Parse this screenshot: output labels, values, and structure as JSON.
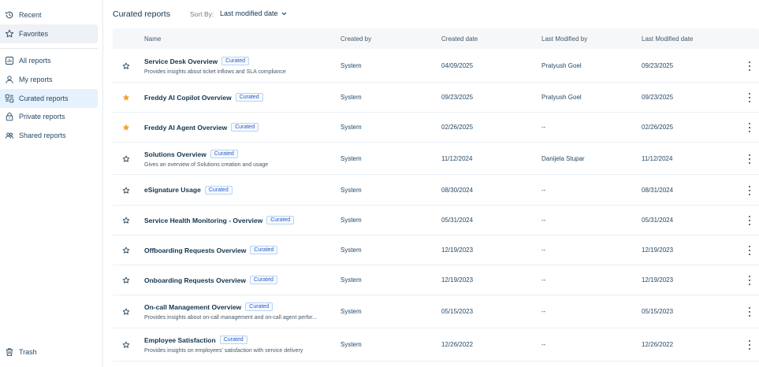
{
  "sidebar": {
    "items": [
      {
        "label": "Recent",
        "icon": "history-icon"
      },
      {
        "label": "Favorites",
        "icon": "star-outline-icon"
      },
      {
        "label": "All reports",
        "icon": "reports-icon"
      },
      {
        "label": "My reports",
        "icon": "user-icon"
      },
      {
        "label": "Curated reports",
        "icon": "curated-icon"
      },
      {
        "label": "Private reports",
        "icon": "lock-icon"
      },
      {
        "label": "Shared reports",
        "icon": "users-icon"
      }
    ],
    "trash": {
      "label": "Trash",
      "icon": "trash-icon"
    }
  },
  "header": {
    "title": "Curated reports",
    "sort_label": "Sort By:",
    "sort_value": "Last modified date"
  },
  "table": {
    "columns": [
      "Name",
      "Created by",
      "Created date",
      "Last Modified by",
      "Last Modified date"
    ],
    "badge_label": "Curated",
    "rows": [
      {
        "name": "Service Desk Overview",
        "desc": "Provides insights about ticket inflows and SLA compliance",
        "favorite": false,
        "created_by": "System",
        "created_date": "04/09/2025",
        "modified_by": "Pratyush Goel",
        "modified_date": "09/23/2025"
      },
      {
        "name": "Freddy AI Copilot Overview",
        "desc": "",
        "favorite": true,
        "created_by": "System",
        "created_date": "09/23/2025",
        "modified_by": "Pratyush Goel",
        "modified_date": "09/23/2025"
      },
      {
        "name": "Freddy AI Agent Overview",
        "desc": "",
        "favorite": true,
        "created_by": "System",
        "created_date": "02/26/2025",
        "modified_by": "--",
        "modified_date": "02/26/2025"
      },
      {
        "name": "Solutions Overview",
        "desc": "Gives an overview of Solutions creation and usage",
        "favorite": false,
        "created_by": "System",
        "created_date": "11/12/2024",
        "modified_by": "Danijela Stupar",
        "modified_date": "11/12/2024"
      },
      {
        "name": "eSignature Usage",
        "desc": "",
        "favorite": false,
        "created_by": "System",
        "created_date": "08/30/2024",
        "modified_by": "--",
        "modified_date": "08/31/2024"
      },
      {
        "name": "Service Health Monitoring - Overview",
        "desc": "",
        "favorite": false,
        "created_by": "System",
        "created_date": "05/31/2024",
        "modified_by": "--",
        "modified_date": "05/31/2024"
      },
      {
        "name": "Offboarding Requests Overview",
        "desc": "",
        "favorite": false,
        "created_by": "System",
        "created_date": "12/19/2023",
        "modified_by": "--",
        "modified_date": "12/19/2023"
      },
      {
        "name": "Onboarding Requests Overview",
        "desc": "",
        "favorite": false,
        "created_by": "System",
        "created_date": "12/19/2023",
        "modified_by": "--",
        "modified_date": "12/19/2023"
      },
      {
        "name": "On-call Management Overview",
        "desc": "Provides insights about on-call management and on-call agent perfor...",
        "favorite": false,
        "created_by": "System",
        "created_date": "05/15/2023",
        "modified_by": "--",
        "modified_date": "05/15/2023"
      },
      {
        "name": "Employee Satisfaction",
        "desc": "Provides insights on employees' satisfaction with service delivery",
        "favorite": false,
        "created_by": "System",
        "created_date": "12/26/2022",
        "modified_by": "--",
        "modified_date": "12/26/2022"
      }
    ]
  },
  "colors": {
    "favorite_star": "#f59e2b",
    "accent": "#2c5cc5",
    "selected_bg": "#e5f2fd"
  }
}
